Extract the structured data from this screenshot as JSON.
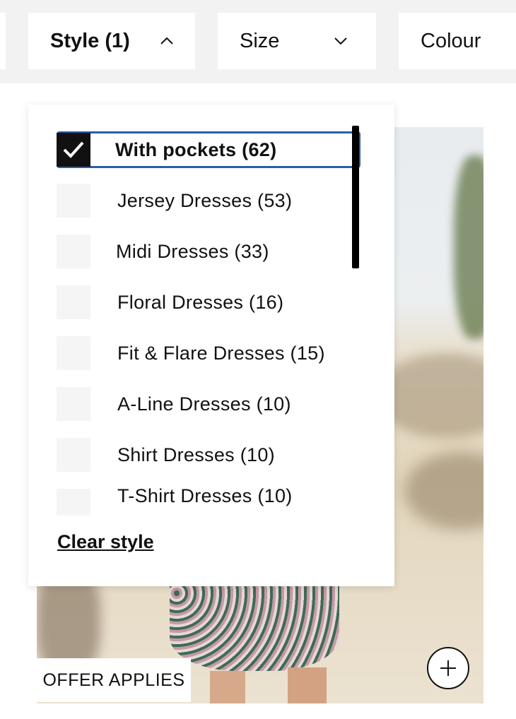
{
  "filters": {
    "style_label": "Style (1)",
    "size_label": "Size",
    "colour_label": "Colour"
  },
  "style_dropdown": {
    "options": [
      {
        "label": "With pockets (62)",
        "checked": true
      },
      {
        "label": "Jersey Dresses (53)",
        "checked": false
      },
      {
        "label": "Midi Dresses (33)",
        "checked": false
      },
      {
        "label": "Floral Dresses (16)",
        "checked": false
      },
      {
        "label": "Fit & Flare Dresses (15)",
        "checked": false
      },
      {
        "label": "A-Line Dresses (10)",
        "checked": false
      },
      {
        "label": "Shirt Dresses (10)",
        "checked": false
      },
      {
        "label": "T-Shirt Dresses (10)",
        "checked": false
      }
    ],
    "clear_label": "Clear style"
  },
  "product": {
    "badge": "OFFER APPLIES",
    "add_icon": "plus-icon"
  },
  "colors": {
    "focus_outline": "#2a5db0",
    "checkbox_checked": "#111111",
    "filter_bar_bg": "#f2f2f2"
  }
}
